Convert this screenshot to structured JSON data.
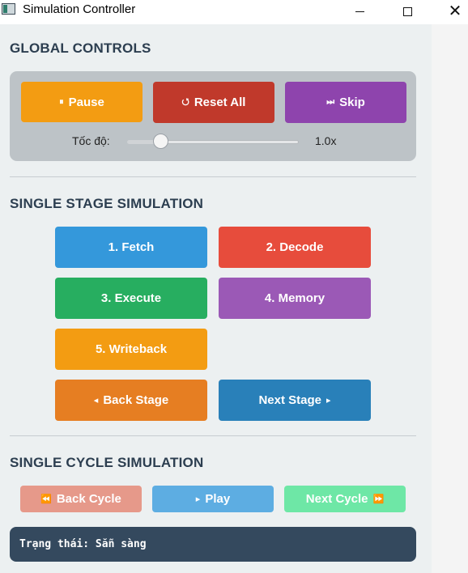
{
  "window": {
    "title": "Simulation Controller",
    "minimize_icon": "minimize-icon",
    "maximize_icon": "maximize-icon",
    "close_label": "✕"
  },
  "global": {
    "heading": "GLOBAL CONTROLS",
    "pause_icon": "⏸",
    "pause_label": "Pause",
    "reset_icon": "⭯",
    "reset_label": "Reset All",
    "skip_icon": "⏭",
    "skip_label": "Skip",
    "speed_label": "Tốc độ:",
    "speed_value": "1.0x",
    "speed_slider_fraction": 0.2
  },
  "stage": {
    "heading": "SINGLE STAGE SIMULATION",
    "fetch_label": "1. Fetch",
    "decode_label": "2. Decode",
    "execute_label": "3. Execute",
    "memory_label": "4. Memory",
    "writeback_label": "5. Writeback",
    "back_icon": "◂",
    "back_label": "Back Stage",
    "next_label": "Next Stage",
    "next_icon": "▸"
  },
  "cycle": {
    "heading": "SINGLE CYCLE SIMULATION",
    "back_icon": "⏪",
    "back_label": "Back Cycle",
    "play_icon": "▸",
    "play_label": "Play",
    "next_label": "Next Cycle",
    "next_icon": "⏩"
  },
  "status": {
    "text": "Trạng thái: Sẵn sàng"
  },
  "colors": {
    "pause": "#f39c12",
    "reset": "#c0392b",
    "skip": "#8e44ad",
    "fetch": "#3498db",
    "decode": "#e74c3c",
    "execute": "#27ae60",
    "memory": "#9b59b6",
    "writeback": "#f39c12",
    "back_stage": "#e67e22",
    "next_stage": "#2980b9",
    "back_cycle": "#e6998a",
    "play": "#5dade2",
    "next_cycle": "#6ee7a6",
    "status_bg": "#34495e"
  }
}
